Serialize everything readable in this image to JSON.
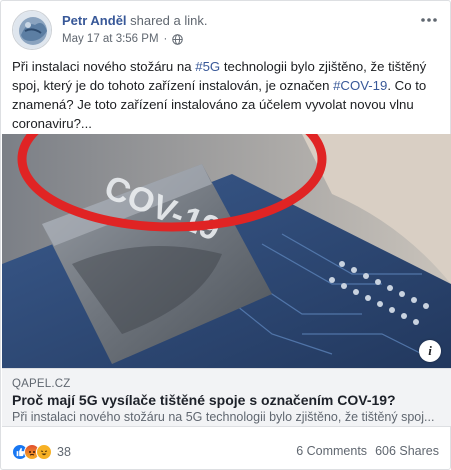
{
  "post": {
    "author": "Petr Anděl",
    "action": "shared a link.",
    "timestamp": "May 17 at 3:56 PM",
    "privacy_icon": "globe-icon",
    "text": {
      "seg1": "Při instalaci nového stožáru na ",
      "hashtag1": "#5G",
      "seg2": " technologii bylo zjištěno, že tištěný spoj, který je do tohoto zařízení instalován, je označen ",
      "hashtag2": "#COV-19",
      "seg3": ". Co to znamená? Je toto zařízení instalováno za účelem vyvolat novou vlnu coronaviru?..."
    }
  },
  "media": {
    "chip_text": "COV-19"
  },
  "link": {
    "domain": "QAPEL.CZ",
    "title": "Proč mají 5G vysílače tištěné spoje s označením COV-19?",
    "description": "Při instalaci nového stožáru na 5G technologii bylo zjištěno, že tištěný spoj..."
  },
  "footer": {
    "reaction_icons": [
      "like-icon",
      "angry-icon",
      "haha-icon"
    ],
    "reaction_count": "38",
    "comments": "6 Comments",
    "shares": "606 Shares"
  },
  "colors": {
    "link_blue": "#385898",
    "like_blue": "#1877f2",
    "angry_red": "#e9710f",
    "haha_yellow": "#f7b125",
    "circle_red": "#e02424"
  }
}
